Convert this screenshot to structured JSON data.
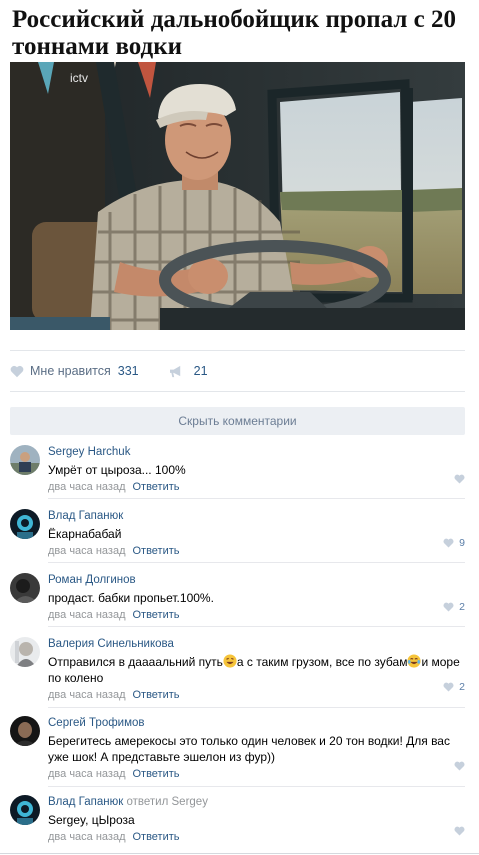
{
  "post": {
    "title": "Российский дальнобойщик пропал с 20 тоннами водки",
    "image_alt": "Пожилой мужчина в кепке за рулём грузовика",
    "image_watermark": "ictv"
  },
  "actions": {
    "like_label": "Мне нравится",
    "like_count": "331",
    "share_count": "21"
  },
  "hide_comments_label": "Скрыть комментарии",
  "comments": [
    {
      "author": "Sergey Harchuk",
      "text": "Умрёт от цыроза... 100%",
      "time": "два часа назад",
      "reply_label": "Ответить",
      "likes": ""
    },
    {
      "author": "Влад Гапанюк",
      "text": "Ёкарнабабай",
      "time": "два часа назад",
      "reply_label": "Ответить",
      "likes": "9"
    },
    {
      "author": "Роман Долгинов",
      "text": "продаст. бабки пропьет.100%.",
      "time": "два часа назад",
      "reply_label": "Ответить",
      "likes": "2"
    },
    {
      "author": "Валерия Синельникова",
      "text_part1": "Отправился в даааальний путь",
      "text_part2": "а с таким грузом, все по зубам",
      "text_part3": "и море по колено",
      "time": "два часа назад",
      "reply_label": "Ответить",
      "likes": "2"
    },
    {
      "author": "Сергей Трофимов",
      "text": "Берегитесь амерекосы это только один человек и 20 тон водки! Для вас уже шок! А представьте эшелон из фур))",
      "time": "два часа назад",
      "reply_label": "Ответить",
      "likes": ""
    },
    {
      "author": "Влад Гапанюк",
      "reply_to_label": "ответил",
      "reply_to_name": "Sergey",
      "text": "Sergey, цЫроза",
      "time": "два часа назад",
      "reply_label": "Ответить",
      "likes": ""
    }
  ],
  "colors": {
    "link": "#2a5885",
    "muted": "#939699",
    "like_icon": "#c6d0dc",
    "button_bg": "#eceff3"
  },
  "icons": {
    "like": "heart-icon",
    "share": "megaphone-icon"
  }
}
